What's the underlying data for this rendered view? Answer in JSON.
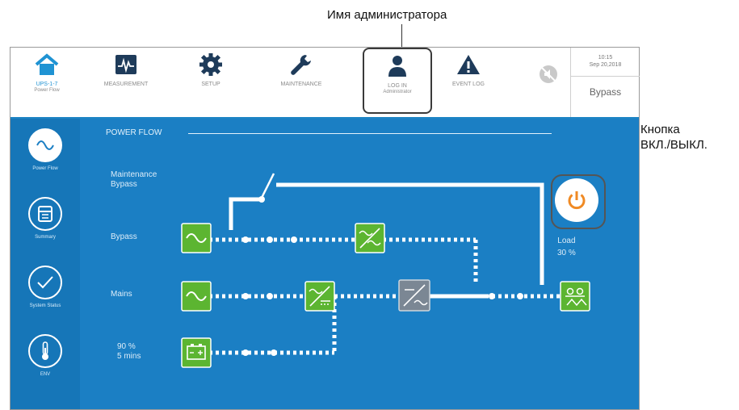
{
  "callouts": {
    "admin_name": "Имя администратора",
    "power_button_line1": "Кнопка",
    "power_button_line2": "ВКЛ./ВЫКЛ."
  },
  "toolbar": {
    "items": [
      {
        "label": "UPS-1-7",
        "sub": "Power Flow",
        "icon": "home-icon"
      },
      {
        "label": "MEASUREMENT",
        "icon": "measurement-icon"
      },
      {
        "label": "SETUP",
        "icon": "gear-icon"
      },
      {
        "label": "MAINTENANCE",
        "icon": "wrench-icon"
      },
      {
        "label": "LOG IN",
        "sub": "Administrator",
        "icon": "user-icon"
      },
      {
        "label": "EVENT LOG",
        "icon": "warning-icon"
      }
    ],
    "mute_icon": "mute-icon",
    "clock_time": "10:15",
    "clock_date": "Sep 20,2018",
    "mode": "Bypass"
  },
  "sidebar": {
    "items": [
      {
        "label": "Power Flow",
        "icon": "sine-wave-icon"
      },
      {
        "label": "Summary",
        "icon": "summary-icon"
      },
      {
        "label": "System Status",
        "icon": "checkmark-icon"
      },
      {
        "label": "ENV",
        "icon": "thermometer-icon"
      }
    ]
  },
  "flow": {
    "title": "POWER FLOW",
    "maintenance_bypass": [
      "Maintenance",
      "Bypass"
    ],
    "bypass": "Bypass",
    "mains": "Mains",
    "battery_percent": "90 %",
    "battery_time": "5 mins",
    "load_label": "Load",
    "load_percent": "30 %"
  },
  "colors": {
    "panel_blue": "#1b7fc4",
    "green_block": "#5cb531",
    "accent_orange": "#f08a24"
  }
}
